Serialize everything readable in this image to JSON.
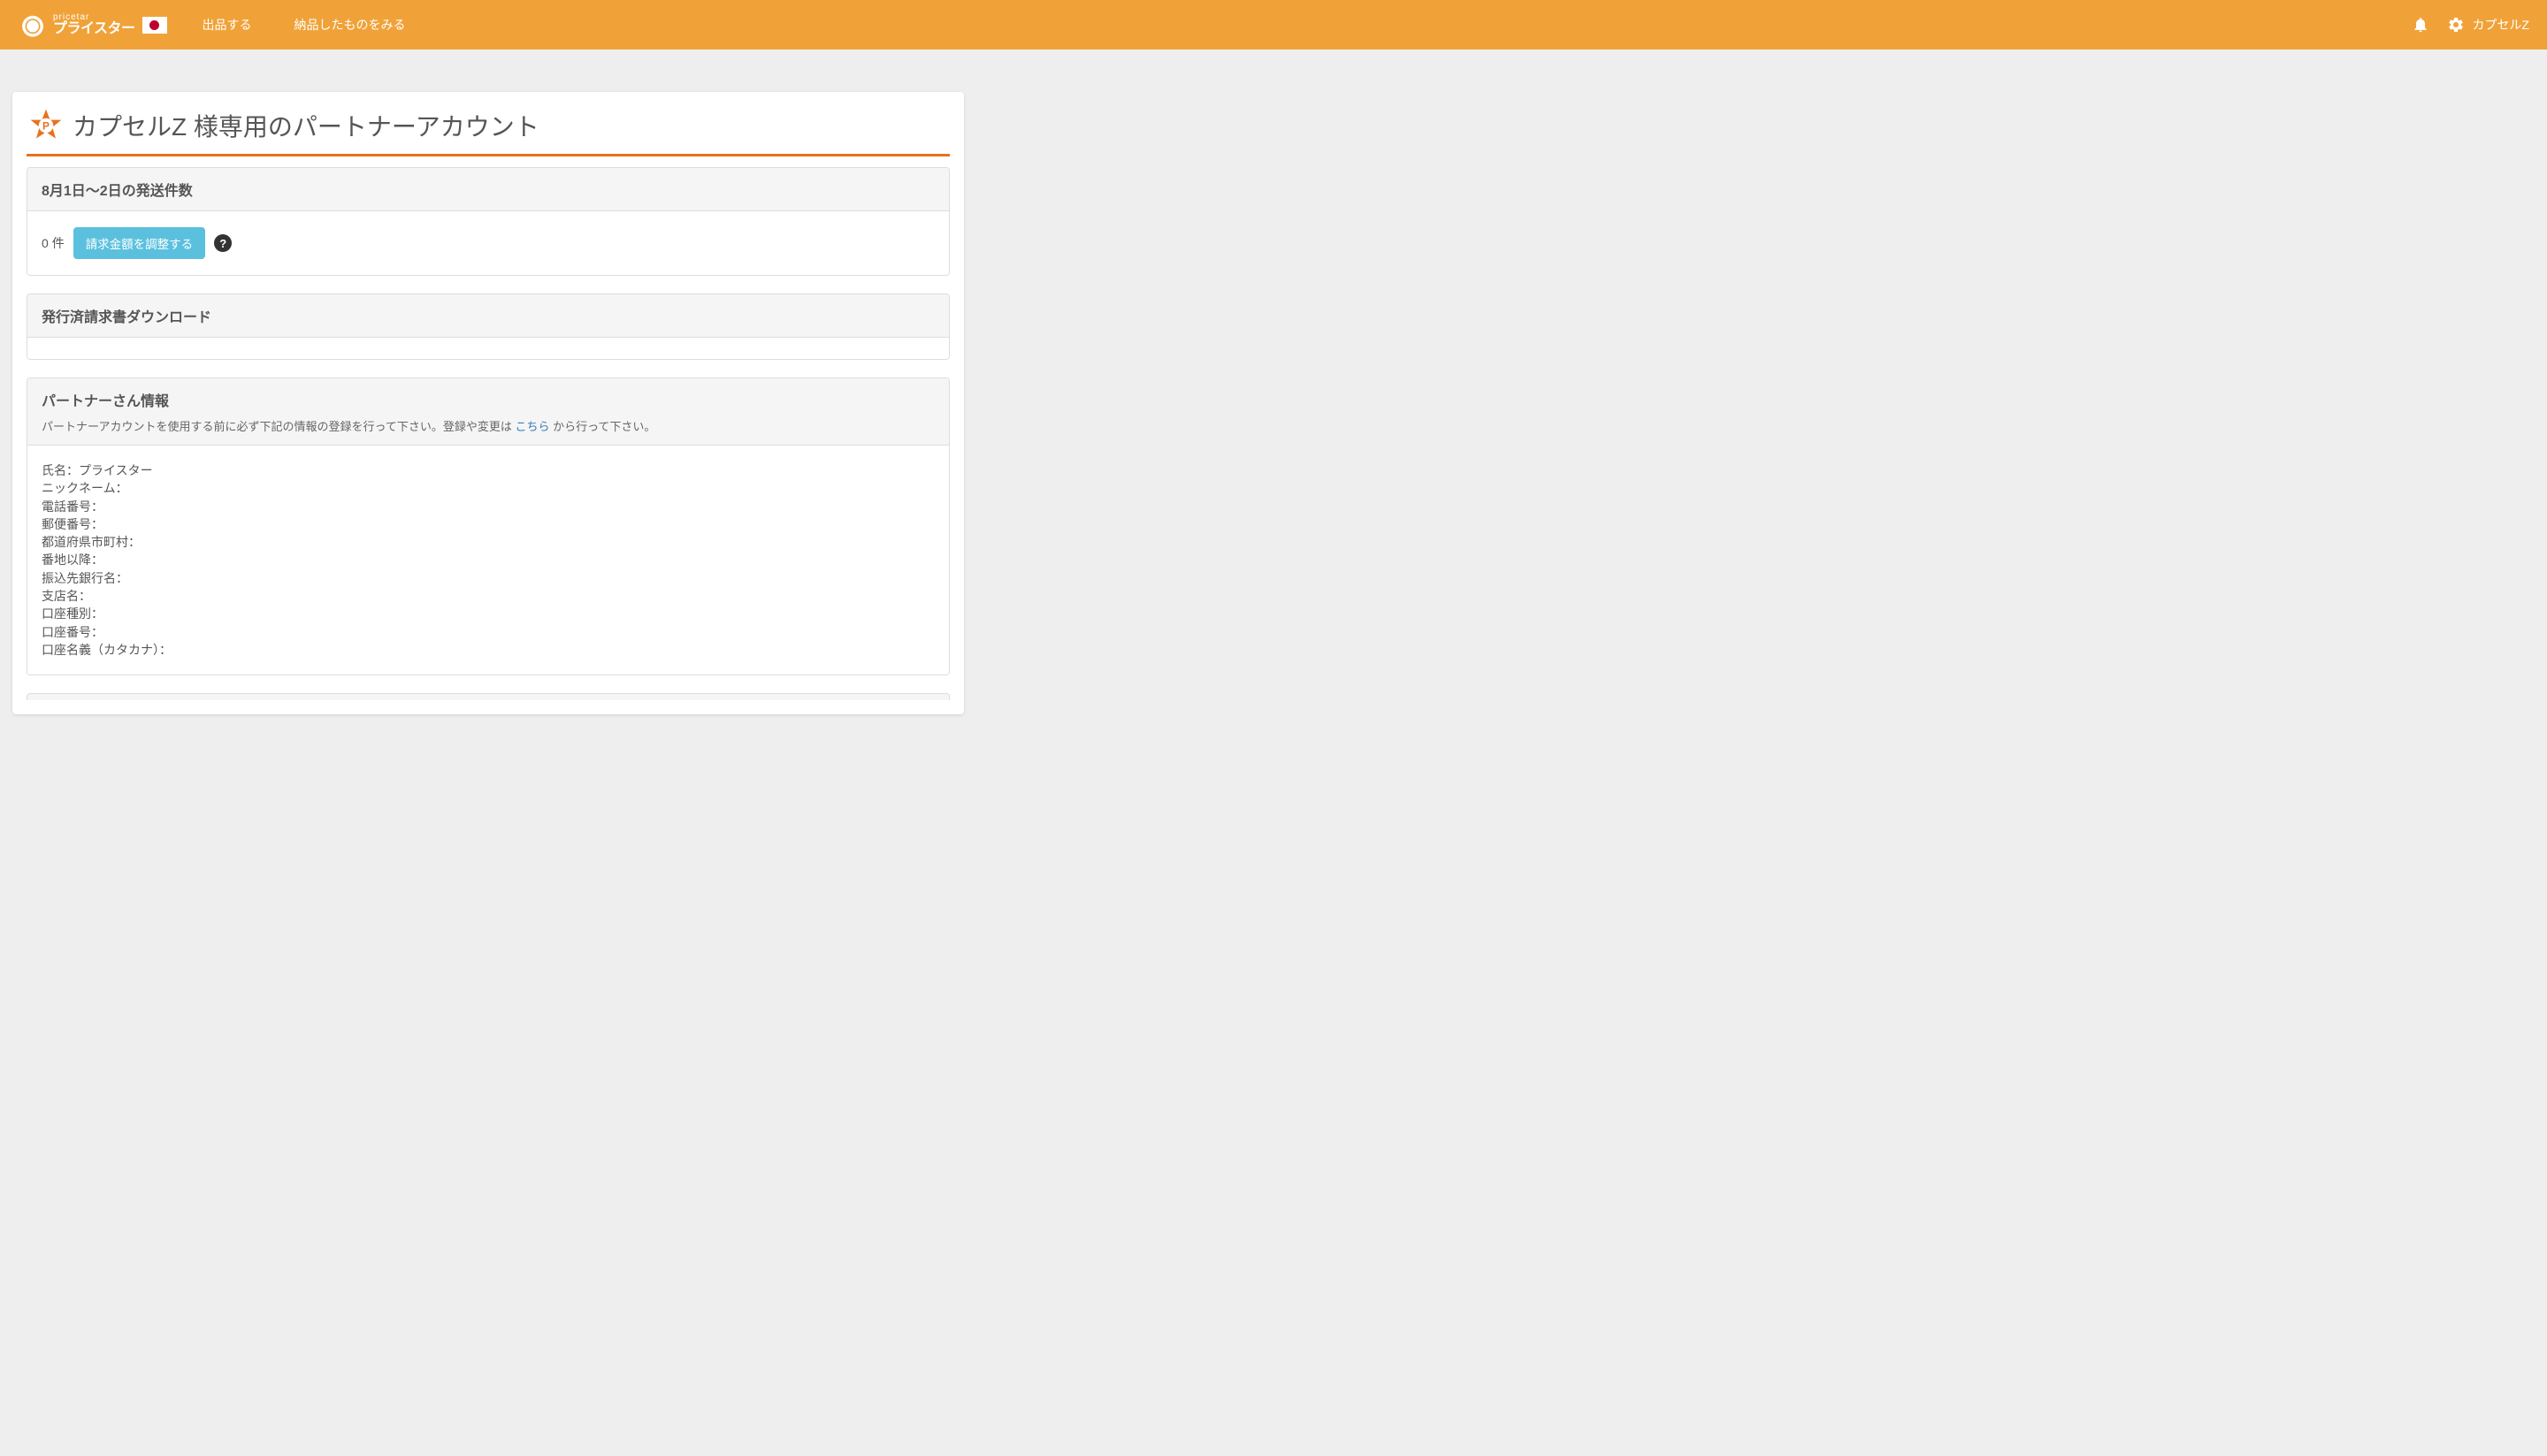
{
  "navbar": {
    "logo_small": "pricetar",
    "logo_main": "プライスター",
    "links": {
      "listing": "出品する",
      "shipped": "納品したものをみる"
    },
    "user_name": "カプセルZ"
  },
  "page": {
    "title": "カプセルZ 様専用のパートナーアカウント"
  },
  "shipment_panel": {
    "heading": "8月1日〜2日の発送件数",
    "count_value": "0",
    "count_unit": "件",
    "adjust_button": "請求金額を調整する"
  },
  "invoice_panel": {
    "heading": "発行済請求書ダウンロード"
  },
  "partner_info_panel": {
    "heading": "パートナーさん情報",
    "description_before": "パートナーアカウントを使用する前に必ず下記の情報の登録を行って下さい。登録や変更は ",
    "description_link": "こちら",
    "description_after": " から行って下さい。",
    "fields": {
      "name_label": "氏名：",
      "name_value": "プライスター",
      "nickname": "ニックネーム：",
      "phone": "電話番号：",
      "postal": "郵便番号：",
      "prefecture": "都道府県市町村：",
      "address": "番地以降：",
      "bank": "振込先銀行名：",
      "branch": "支店名：",
      "account_type": "口座種別：",
      "account_number": "口座番号：",
      "account_holder": "口座名義（カタカナ）："
    }
  }
}
